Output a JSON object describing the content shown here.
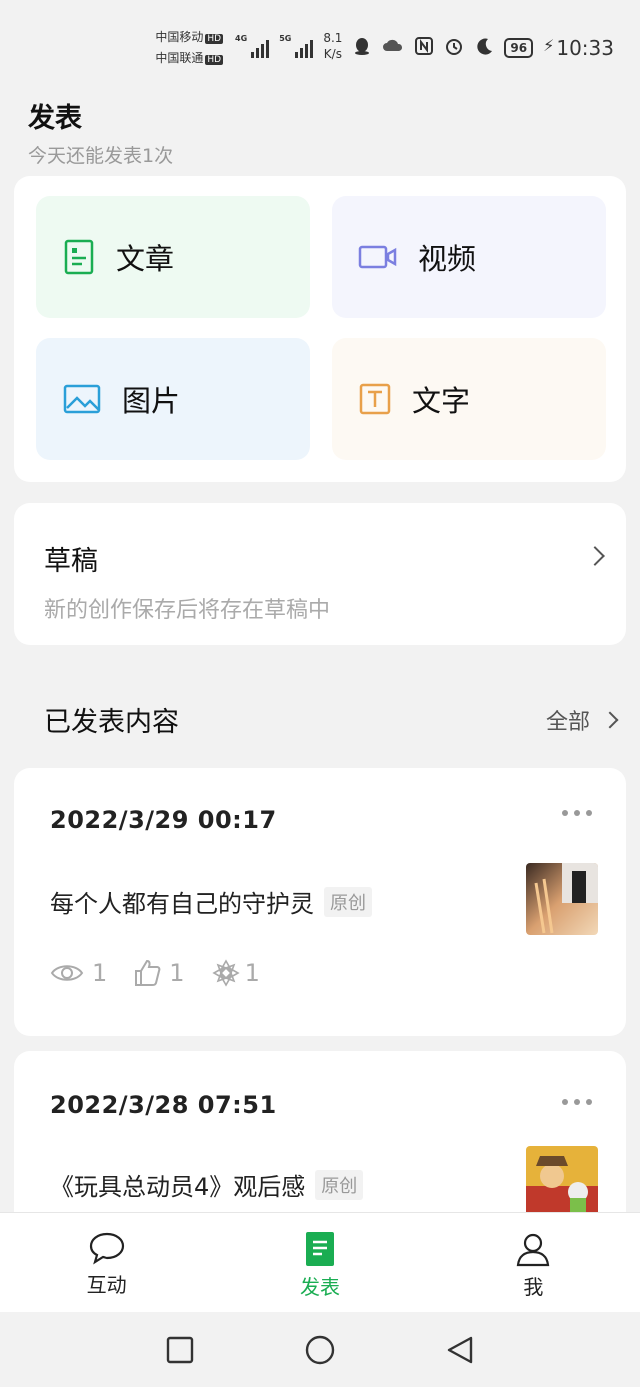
{
  "status_bar": {
    "carrier1": "中国移动",
    "carrier2": "中国联通",
    "hd": "HD",
    "net1": "4G",
    "net2": "5G",
    "speed_value": "8.1",
    "speed_unit": "K/s",
    "battery": "96",
    "time": "10:33"
  },
  "header": {
    "title": "发表",
    "subtitle": "今天还能发表1次"
  },
  "publish_types": [
    {
      "label": "文章",
      "icon": "article-icon",
      "color": "#1aad52"
    },
    {
      "label": "视频",
      "icon": "video-icon",
      "color": "#7b7fe0"
    },
    {
      "label": "图片",
      "icon": "image-icon",
      "color": "#2a9fd8"
    },
    {
      "label": "文字",
      "icon": "text-icon",
      "color": "#e8a04a"
    }
  ],
  "drafts": {
    "title": "草稿",
    "subtitle": "新的创作保存后将存在草稿中"
  },
  "published": {
    "title": "已发表内容",
    "all_label": "全部",
    "posts": [
      {
        "date": "2022/3/29 00:17",
        "title": "每个人都有自己的守护灵",
        "tag": "原创",
        "views": "1",
        "likes": "1",
        "shares": "1"
      },
      {
        "date": "2022/3/28 07:51",
        "title": "《玩具总动员4》观后感",
        "tag": "原创"
      }
    ]
  },
  "tabbar": {
    "tabs": [
      {
        "label": "互动",
        "icon": "chat-bubble-icon"
      },
      {
        "label": "发表",
        "icon": "document-icon",
        "active": true
      },
      {
        "label": "我",
        "icon": "person-icon"
      }
    ]
  },
  "colors": {
    "accent": "#1aad52",
    "background": "#f2f2f2"
  }
}
